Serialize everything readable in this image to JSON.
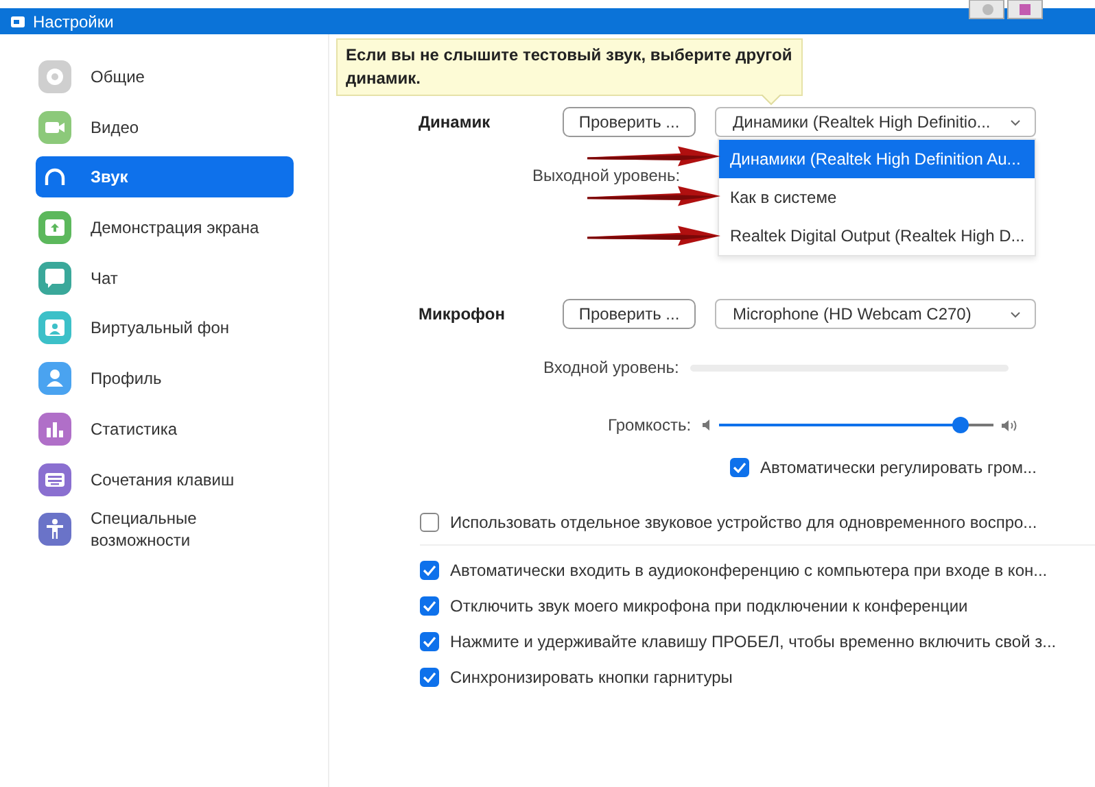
{
  "window": {
    "title": "Настройки"
  },
  "sidebar": {
    "items": [
      {
        "label": "Общие",
        "selected": false
      },
      {
        "label": "Видео",
        "selected": false
      },
      {
        "label": "Звук",
        "selected": true
      },
      {
        "label": "Демонстрация экрана",
        "selected": false
      },
      {
        "label": "Чат",
        "selected": false
      },
      {
        "label": "Виртуальный фон",
        "selected": false
      },
      {
        "label": "Профиль",
        "selected": false
      },
      {
        "label": "Статистика",
        "selected": false
      },
      {
        "label": "Сочетания клавиш",
        "selected": false
      },
      {
        "label": "Специальные возможности",
        "selected": false
      }
    ]
  },
  "tooltip": "Если вы не слышите тестовый звук, выберите другой динамик.",
  "speaker": {
    "label": "Динамик",
    "test_button": "Проверить ...",
    "device": "Динамики (Realtek High Definitio...",
    "output_level_label": "Выходной уровень:",
    "options": [
      {
        "label": "Динамики (Realtek High Definition Au...",
        "selected": true
      },
      {
        "label": "Как в системе",
        "selected": false
      },
      {
        "label": "Realtek Digital Output (Realtek High D...",
        "selected": false
      }
    ]
  },
  "microphone": {
    "label": "Микрофон",
    "test_button": "Проверить ...",
    "device": "Microphone (HD Webcam C270)",
    "input_level_label": "Входной уровень:",
    "input_level": {
      "level": 0
    },
    "volume_label": "Громкость:",
    "volume": {
      "level": 0.83
    },
    "auto_adjust": {
      "label": "Автоматически регулировать гром...",
      "checked": true
    }
  },
  "separate_device": {
    "label": "Использовать отдельное звуковое устройство для одновременного воспро...",
    "checked": false
  },
  "options": [
    {
      "label": "Автоматически входить в аудиоконференцию с компьютера при входе в кон...",
      "checked": true
    },
    {
      "label": "Отключить звук моего микрофона при подключении к конференции",
      "checked": true
    },
    {
      "label": "Нажмите и удерживайте клавишу ПРОБЕЛ, чтобы временно включить свой з...",
      "checked": true
    },
    {
      "label": "Синхронизировать кнопки гарнитуры",
      "checked": true
    }
  ]
}
